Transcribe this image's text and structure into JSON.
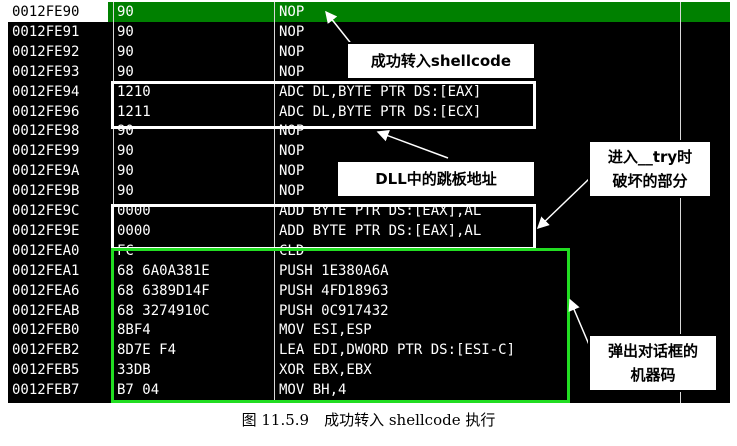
{
  "rows": [
    {
      "addr": "0012FE90",
      "hex": "90",
      "dis": "NOP",
      "selected": true
    },
    {
      "addr": "0012FE91",
      "hex": "90",
      "dis": "NOP"
    },
    {
      "addr": "0012FE92",
      "hex": "90",
      "dis": "NOP"
    },
    {
      "addr": "0012FE93",
      "hex": "90",
      "dis": "NOP"
    },
    {
      "addr": "0012FE94",
      "hex": "1210",
      "dis": "ADC DL,BYTE PTR DS:[EAX]"
    },
    {
      "addr": "0012FE96",
      "hex": "1211",
      "dis": "ADC DL,BYTE PTR DS:[ECX]"
    },
    {
      "addr": "0012FE98",
      "hex": "90",
      "dis": "NOP"
    },
    {
      "addr": "0012FE99",
      "hex": "90",
      "dis": "NOP"
    },
    {
      "addr": "0012FE9A",
      "hex": "90",
      "dis": "NOP"
    },
    {
      "addr": "0012FE9B",
      "hex": "90",
      "dis": "NOP"
    },
    {
      "addr": "0012FE9C",
      "hex": "0000",
      "dis": "ADD BYTE PTR DS:[EAX],AL"
    },
    {
      "addr": "0012FE9E",
      "hex": "0000",
      "dis": "ADD BYTE PTR DS:[EAX],AL"
    },
    {
      "addr": "0012FEA0",
      "hex": "FC",
      "dis": "CLD"
    },
    {
      "addr": "0012FEA1",
      "hex": "68 6A0A381E",
      "dis": "PUSH 1E380A6A"
    },
    {
      "addr": "0012FEA6",
      "hex": "68 6389D14F",
      "dis": "PUSH 4FD18963"
    },
    {
      "addr": "0012FEAB",
      "hex": "68 3274910C",
      "dis": "PUSH 0C917432"
    },
    {
      "addr": "0012FEB0",
      "hex": "8BF4",
      "dis": "MOV ESI,ESP"
    },
    {
      "addr": "0012FEB2",
      "hex": "8D7E F4",
      "dis": "LEA EDI,DWORD PTR DS:[ESI-C]"
    },
    {
      "addr": "0012FEB5",
      "hex": "33DB",
      "dis": "XOR EBX,EBX"
    },
    {
      "addr": "0012FEB7",
      "hex": "B7 04",
      "dis": "MOV BH,4"
    }
  ],
  "callouts": {
    "shellcode": "成功转入shellcode",
    "dll": "DLL中的跳板地址",
    "try_line1": "进入__try时",
    "try_line2": "破坏的部分",
    "machine_line1": "弹出对话框的",
    "machine_line2": "机器码"
  },
  "caption": "图 11.5.9　成功转入 shellcode 执行",
  "colors": {
    "background": "#000000",
    "selected_row": "#008000",
    "highlight_box_green": "#22dd22",
    "highlight_box_white": "#ffffff"
  }
}
